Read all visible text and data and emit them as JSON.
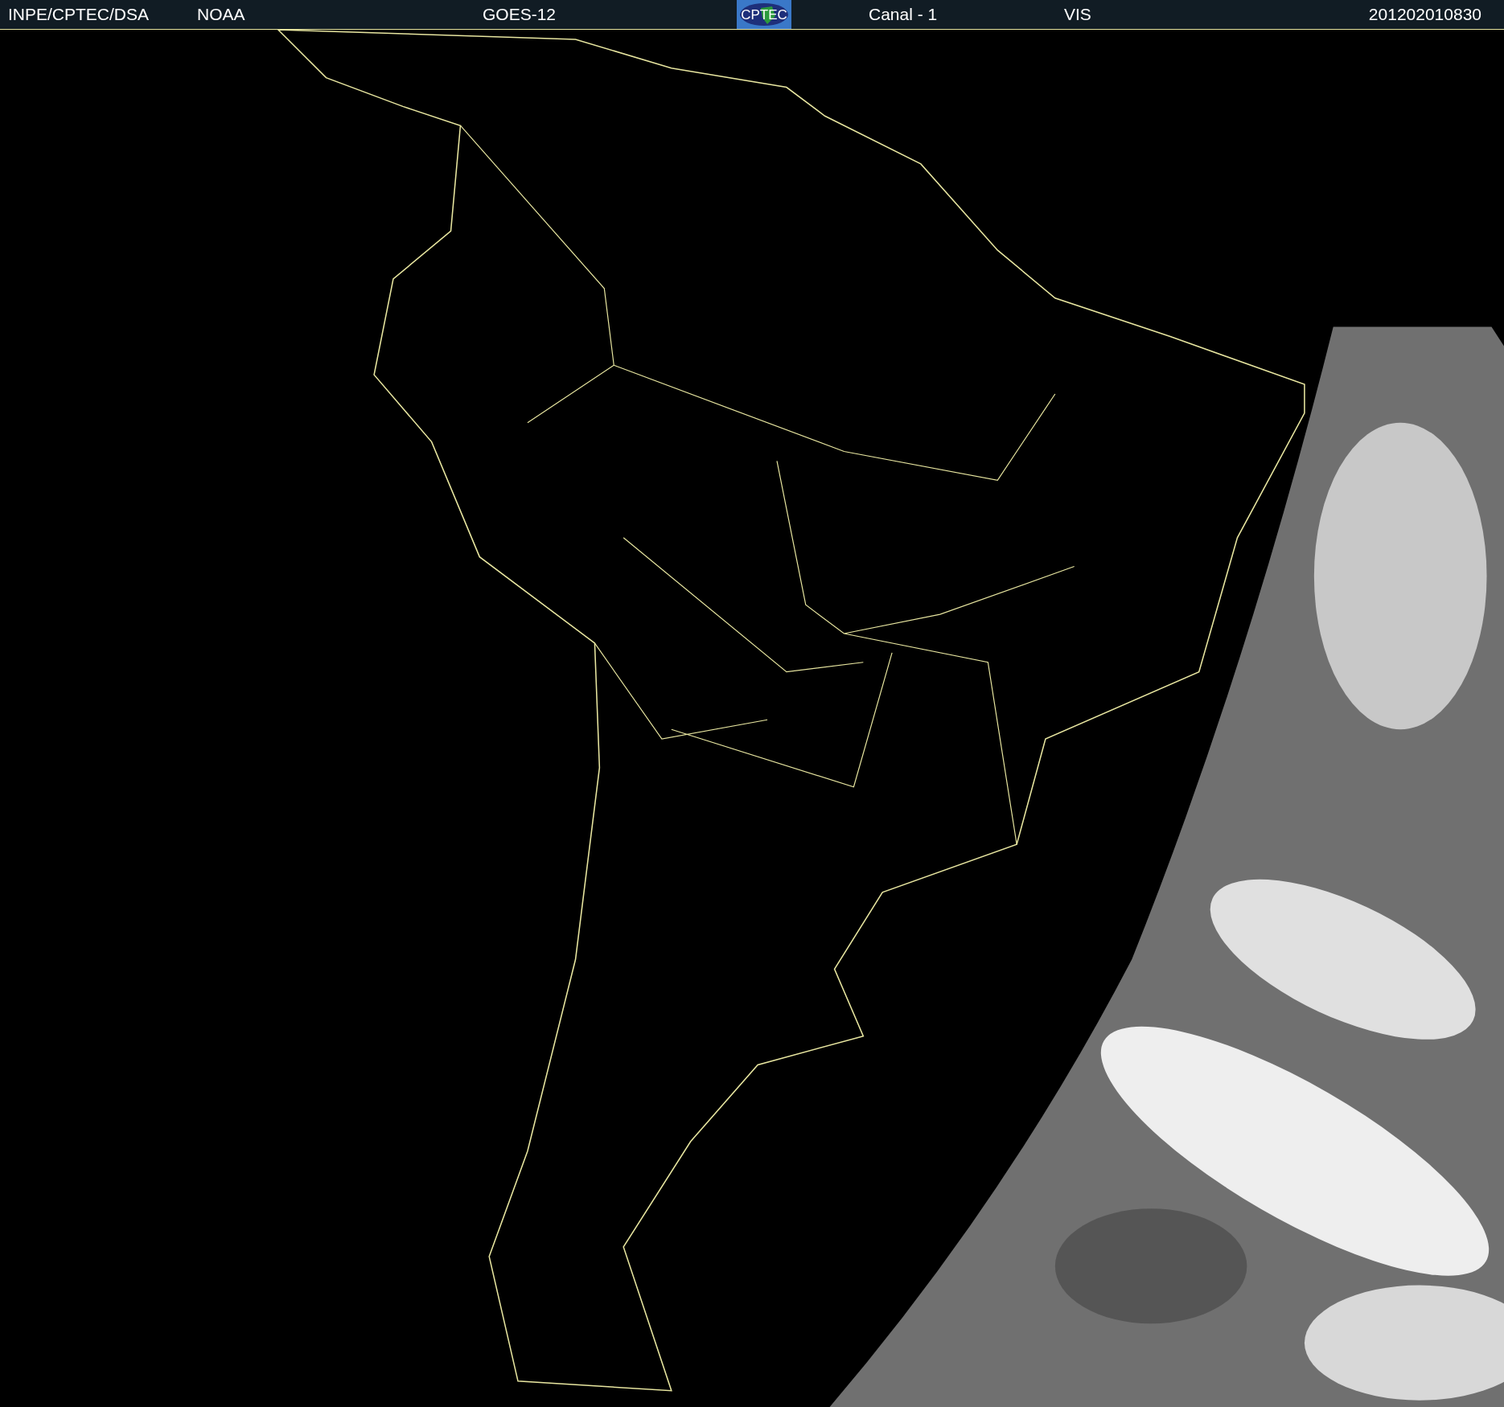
{
  "header": {
    "items": [
      {
        "kind": "text",
        "text": "INPE/CPTEC/DSA"
      },
      {
        "kind": "text",
        "text": "NOAA"
      },
      {
        "kind": "text",
        "text": "GOES-12"
      },
      {
        "kind": "logo",
        "text": "CPTEC"
      },
      {
        "kind": "text",
        "text": "Canal - 1"
      },
      {
        "kind": "text",
        "text": "VIS"
      },
      {
        "kind": "date",
        "text": "201202010830"
      }
    ]
  }
}
